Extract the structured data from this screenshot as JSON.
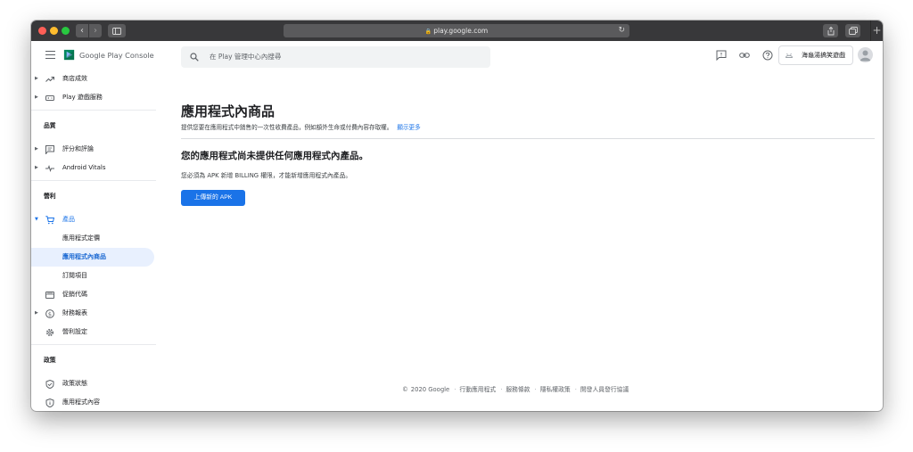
{
  "browser": {
    "url": "play.google.com"
  },
  "app": {
    "logo_text": "Google Play Console"
  },
  "sidebar": {
    "items": [
      {
        "label": "商店成效"
      },
      {
        "label": "Play 遊戲服務"
      },
      {
        "section": "品質"
      },
      {
        "label": "評分和評論"
      },
      {
        "label": "Android Vitals"
      },
      {
        "section": "營利"
      },
      {
        "label": "產品"
      },
      {
        "label": "應用程式定價"
      },
      {
        "label": "應用程式內商品"
      },
      {
        "label": "訂閱項目"
      },
      {
        "label": "促銷代碼"
      },
      {
        "label": "財務報表"
      },
      {
        "label": "營利設定"
      },
      {
        "section": "政策"
      },
      {
        "label": "政策狀態"
      },
      {
        "label": "應用程式內容"
      }
    ]
  },
  "topbar": {
    "search_placeholder": "在 Play 管理中心內搜尋",
    "developer_name": "海龜湯搞笑遊戲"
  },
  "main": {
    "title": "應用程式內商品",
    "description": "提供您要在應用程式中銷售的一次性收費產品，例如額外生命或付費內容存取權。",
    "learn_more": "顯示更多",
    "empty_title": "您的應用程式尚未提供任何應用程式內產品。",
    "empty_desc": "您必須為 APK 新增 BILLING 權限，才能新增應用程式內產品。",
    "upload_button": "上傳新的 APK"
  },
  "footer": {
    "copyright": "2020 Google",
    "links": [
      "行動應用程式",
      "服務條款",
      "隱私權政策",
      "開發人員發行協議"
    ]
  },
  "colors": {
    "accent": "#1a73e8",
    "selected_bg": "#e8f0fe"
  }
}
